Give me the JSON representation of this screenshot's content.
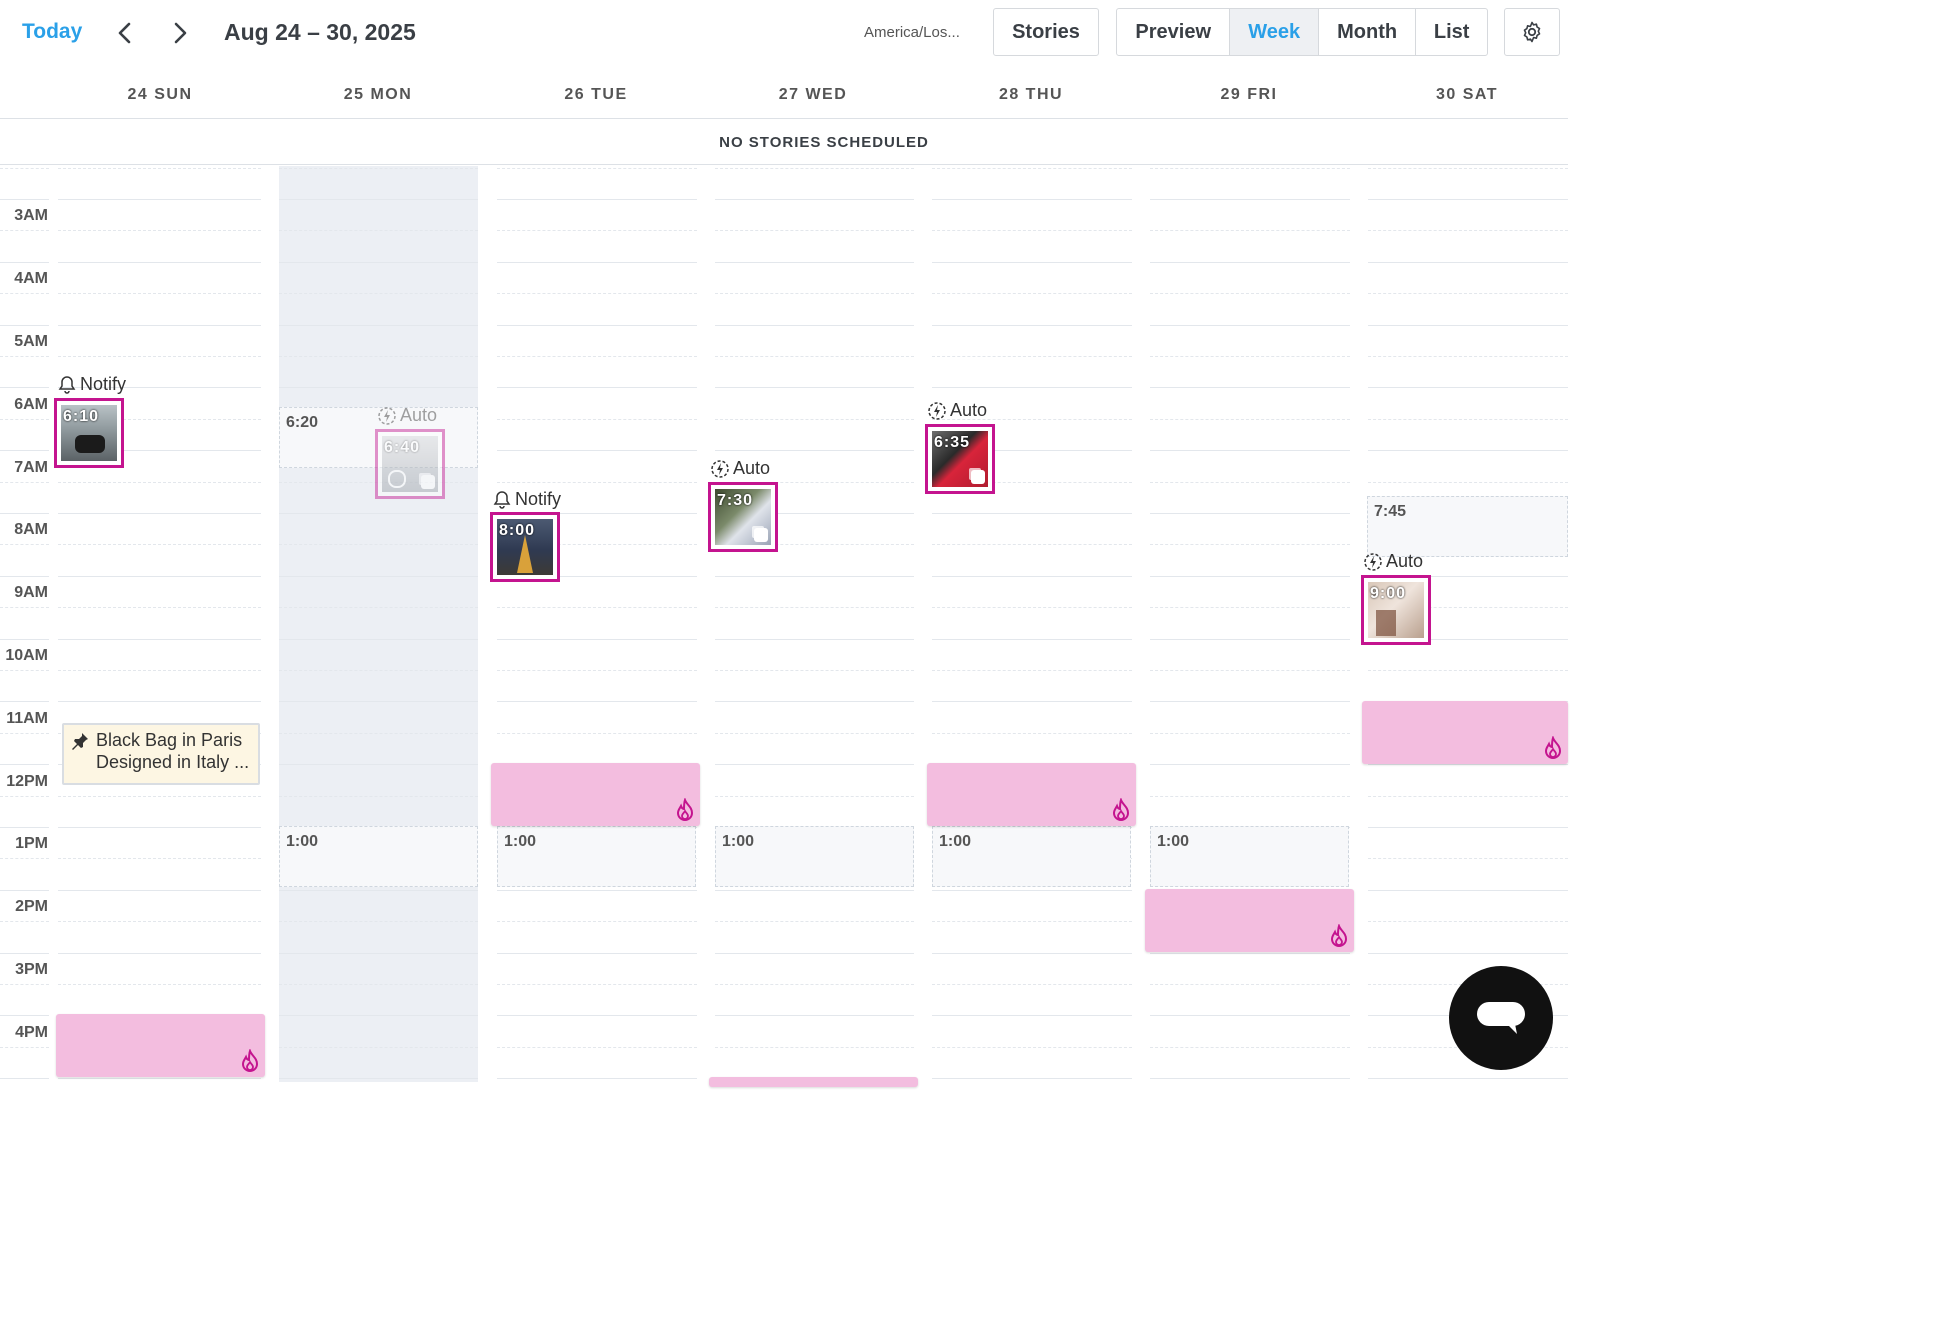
{
  "toolbar": {
    "today_label": "Today",
    "date_range": "Aug 24 – 30, 2025",
    "timezone": "America/Los...",
    "stories_label": "Stories",
    "views": [
      "Preview",
      "Week",
      "Month",
      "List"
    ],
    "active_view": "Week"
  },
  "days": [
    "24 SUN",
    "25 MON",
    "26 TUE",
    "27 WED",
    "28 THU",
    "29 FRI",
    "30 SAT"
  ],
  "no_stories_banner": "NO STORIES SCHEDULED",
  "hours": [
    "3AM",
    "4AM",
    "5AM",
    "6AM",
    "7AM",
    "8AM",
    "9AM",
    "10AM",
    "11AM",
    "12PM",
    "1PM",
    "2PM",
    "3PM",
    "4PM"
  ],
  "posts": {
    "sun": {
      "tag": "Notify",
      "time": "6:10"
    },
    "mon": {
      "tag": "Auto",
      "time": "6:40",
      "slot_time": "6:20"
    },
    "tue": {
      "tag": "Notify",
      "time": "8:00"
    },
    "wed": {
      "tag": "Auto",
      "time": "7:30"
    },
    "thu": {
      "tag": "Auto",
      "time": "6:35"
    },
    "sat": {
      "tag": "Auto",
      "time": "9:00",
      "slot_time": "7:45"
    }
  },
  "slots_1pm": [
    "1:00",
    "1:00",
    "1:00",
    "1:00",
    "1:00"
  ],
  "pinned_note": {
    "line1": "Black Bag in Paris",
    "line2": "Designed in Italy ..."
  },
  "colors": {
    "accent": "#2aa0e8",
    "post_border": "#c4148f",
    "pink_block": "#f3bddf",
    "monday_bg": "#eceff4"
  }
}
